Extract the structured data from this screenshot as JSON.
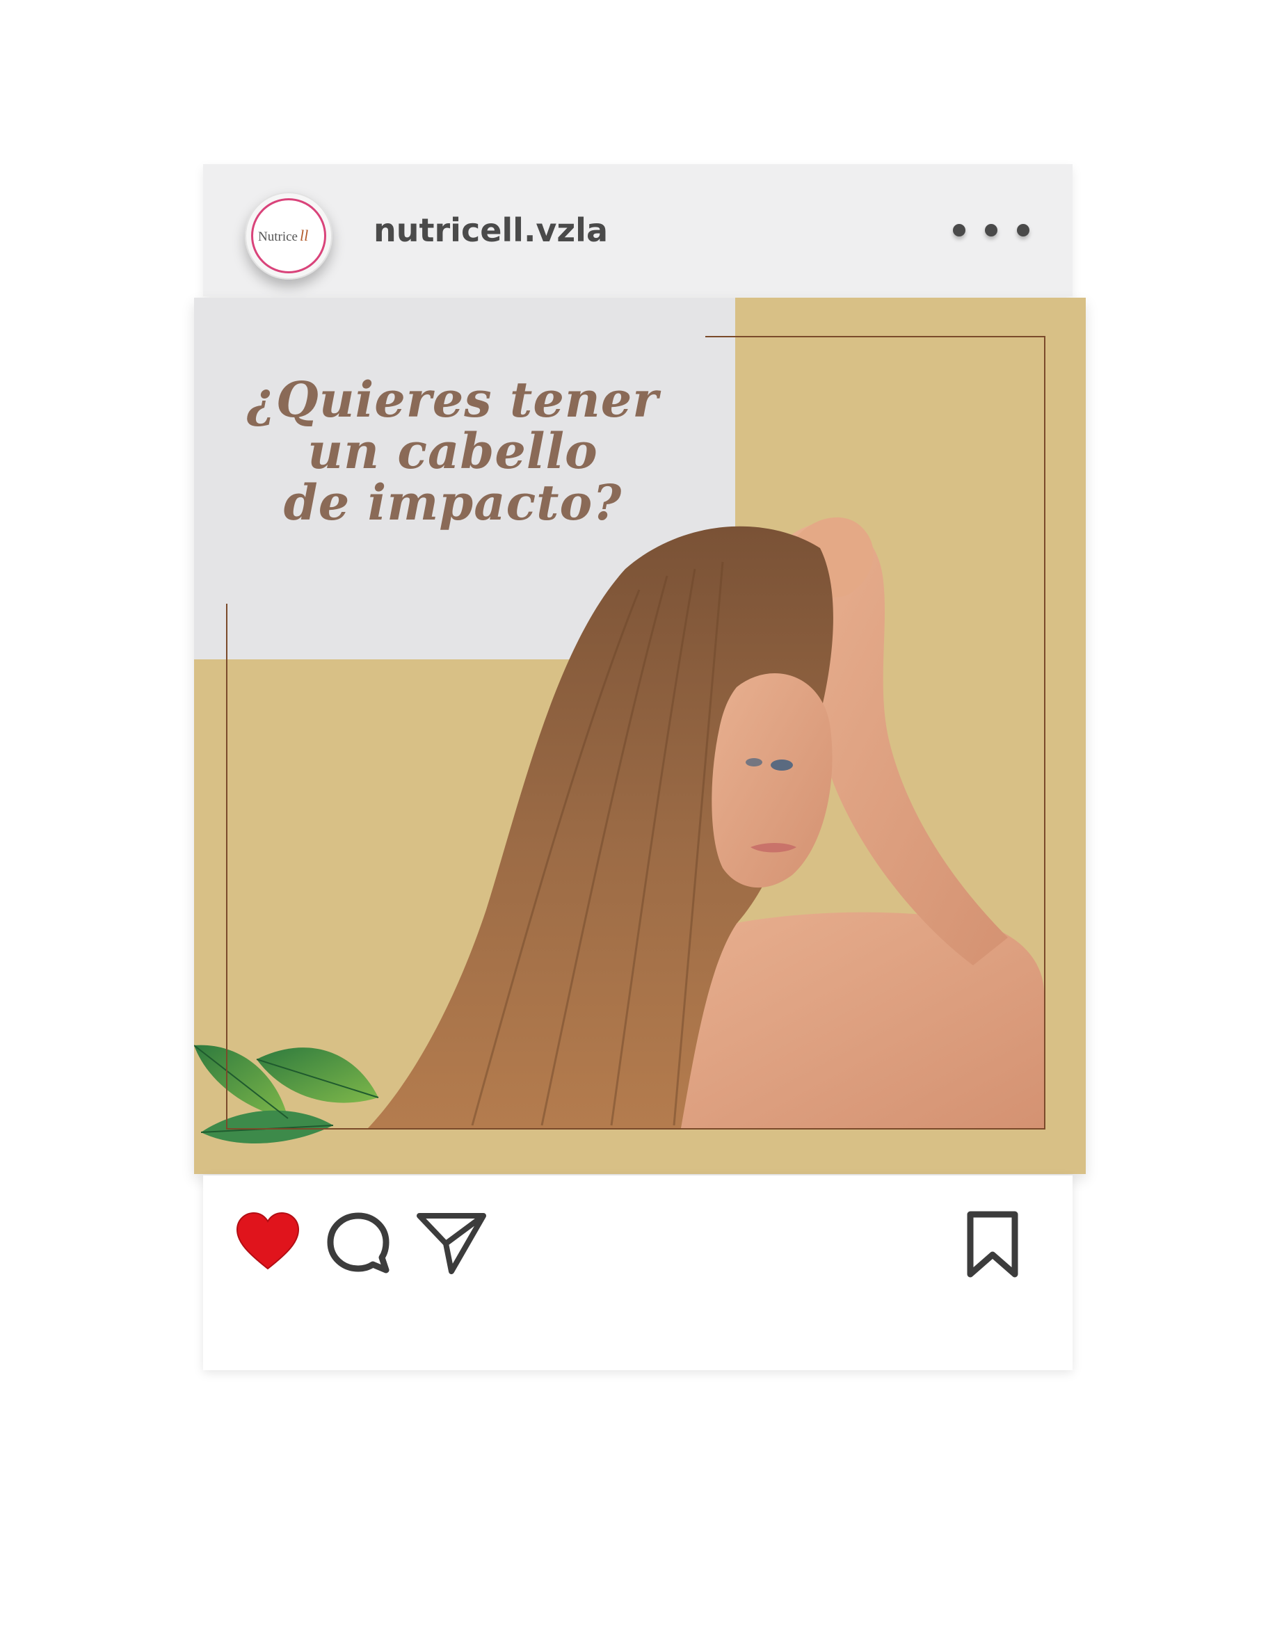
{
  "header": {
    "avatar_logo_text": "Nutricell",
    "username": "nutricell.vzla"
  },
  "post": {
    "headline_lines": [
      "¿Quieres tener",
      "un cabello",
      "de impacto?"
    ]
  },
  "actions": {
    "liked": true,
    "like_color": "#e0141c",
    "icons": [
      "heart-icon",
      "comment-icon",
      "send-icon",
      "bookmark-icon"
    ]
  },
  "colors": {
    "post_background": "#d8c086",
    "grey_block": "#e4e4e6",
    "headline": "#8a6a57",
    "frame_line": "#7a4a2a"
  }
}
